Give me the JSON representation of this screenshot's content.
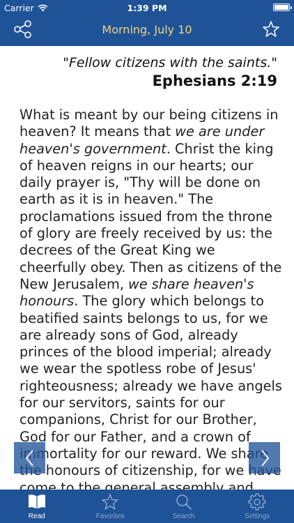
{
  "status_bar": {
    "carrier": "Carrier",
    "time": "1:39 PM"
  },
  "nav": {
    "title": "Morning, July 10",
    "left_icon": "share-icon",
    "right_icon": "star-icon"
  },
  "verse": {
    "quote": "\"Fellow citizens with the saints.\"",
    "reference": "Ephesians 2:19"
  },
  "devotional": {
    "p1": "What is meant by our being citizens in heaven? It means that ",
    "em1": "we are under heaven's government",
    "p2": ". Christ the king of heaven reigns in our hearts; our daily prayer is, \"Thy will be done on earth as it is in heaven.\" The proclamations issued from the throne of glory are freely received by us: the decrees of the Great King we cheerfully obey. Then as citizens of the New Jerusalem, ",
    "em2": "we share heaven's honours",
    "p3": ". The glory which belongs to beatified saints belongs to us, for we are already sons of God, already princes of the blood imperial; already we wear the spotless robe of Jesus' righteousness; already we have angels for our servitors, saints for our companions, Christ for our Brother, God for our Father, and a crown of immortality for our reward. We share the honours of citizenship, for we have come to the general assembly and church of the firstborn."
  },
  "nav_arrows": {
    "prev_icon": "chevron-left-icon",
    "next_icon": "chevron-right-icon"
  },
  "tabs": [
    {
      "label": "Read",
      "icon": "book-icon",
      "active": true
    },
    {
      "label": "Favorites",
      "icon": "star-icon",
      "active": false
    },
    {
      "label": "Search",
      "icon": "search-icon",
      "active": false
    },
    {
      "label": "Settings",
      "icon": "gear-icon",
      "active": false
    }
  ],
  "colors": {
    "bar": "#1f5398",
    "title": "#f1d37a",
    "tab_inactive": "#8fa7cc",
    "tab_active": "#ffffff"
  }
}
